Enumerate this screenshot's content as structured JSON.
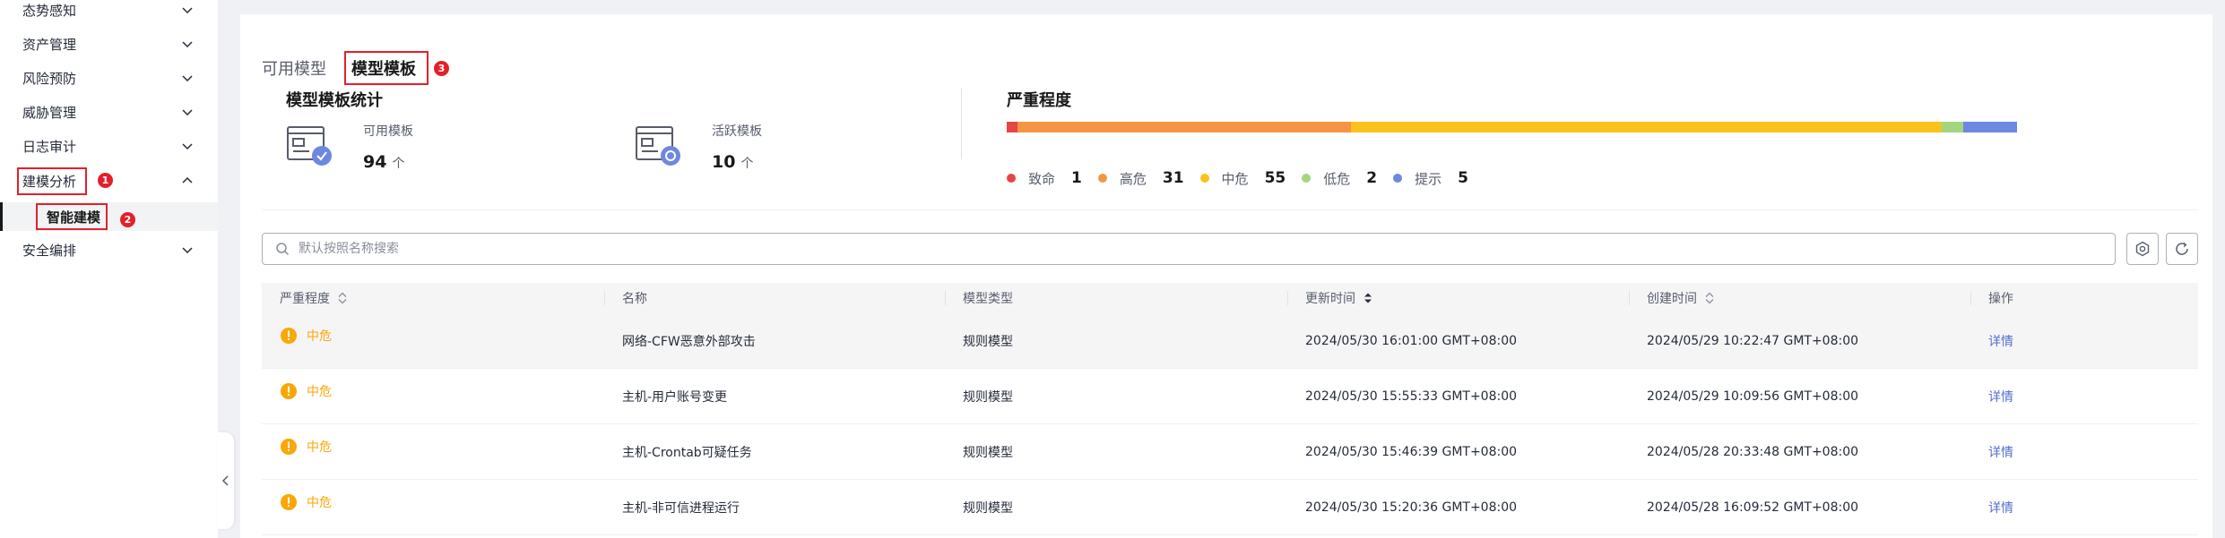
{
  "sidebar": {
    "items": [
      {
        "label": "态势感知"
      },
      {
        "label": "资产管理"
      },
      {
        "label": "风险预防"
      },
      {
        "label": "威胁管理"
      },
      {
        "label": "日志审计"
      },
      {
        "label": "建模分析"
      },
      {
        "label": "安全编排"
      }
    ],
    "sub_item": "智能建模",
    "callouts": [
      "1",
      "2",
      "3"
    ]
  },
  "tabs": [
    {
      "label": "可用模型"
    },
    {
      "label": "模型模板"
    }
  ],
  "stats": {
    "title": "模型模板统计",
    "available": {
      "label": "可用模板",
      "value": "94",
      "unit": "个"
    },
    "active": {
      "label": "活跃模板",
      "value": "10",
      "unit": "个"
    }
  },
  "severity": {
    "title": "严重程度",
    "levels": [
      {
        "name": "致命",
        "count": 1,
        "color": "#e54545"
      },
      {
        "name": "高危",
        "count": 31,
        "color": "#f59543"
      },
      {
        "name": "中危",
        "count": 55,
        "color": "#fbc21c"
      },
      {
        "name": "低危",
        "count": 2,
        "color": "#a4d57f"
      },
      {
        "name": "提示",
        "count": 5,
        "color": "#6d88e0"
      }
    ]
  },
  "search": {
    "placeholder": "默认按照名称搜索"
  },
  "table": {
    "columns": [
      "严重程度",
      "名称",
      "模型类型",
      "更新时间",
      "创建时间",
      "操作"
    ],
    "rows": [
      {
        "severity": "中危",
        "name": "网络-CFW恶意外部攻击",
        "type": "规则模型",
        "updated": "2024/05/30 16:01:00 GMT+08:00",
        "created": "2024/05/29 10:22:47 GMT+08:00",
        "action": "详情"
      },
      {
        "severity": "中危",
        "name": "主机-用户账号变更",
        "type": "规则模型",
        "updated": "2024/05/30 15:55:33 GMT+08:00",
        "created": "2024/05/29 10:09:56 GMT+08:00",
        "action": "详情"
      },
      {
        "severity": "中危",
        "name": "主机-Crontab可疑任务",
        "type": "规则模型",
        "updated": "2024/05/30 15:46:39 GMT+08:00",
        "created": "2024/05/28 20:33:48 GMT+08:00",
        "action": "详情"
      },
      {
        "severity": "中危",
        "name": "主机-非可信进程运行",
        "type": "规则模型",
        "updated": "2024/05/30 15:20:36 GMT+08:00",
        "created": "2024/05/28 16:09:52 GMT+08:00",
        "action": "详情"
      }
    ]
  }
}
